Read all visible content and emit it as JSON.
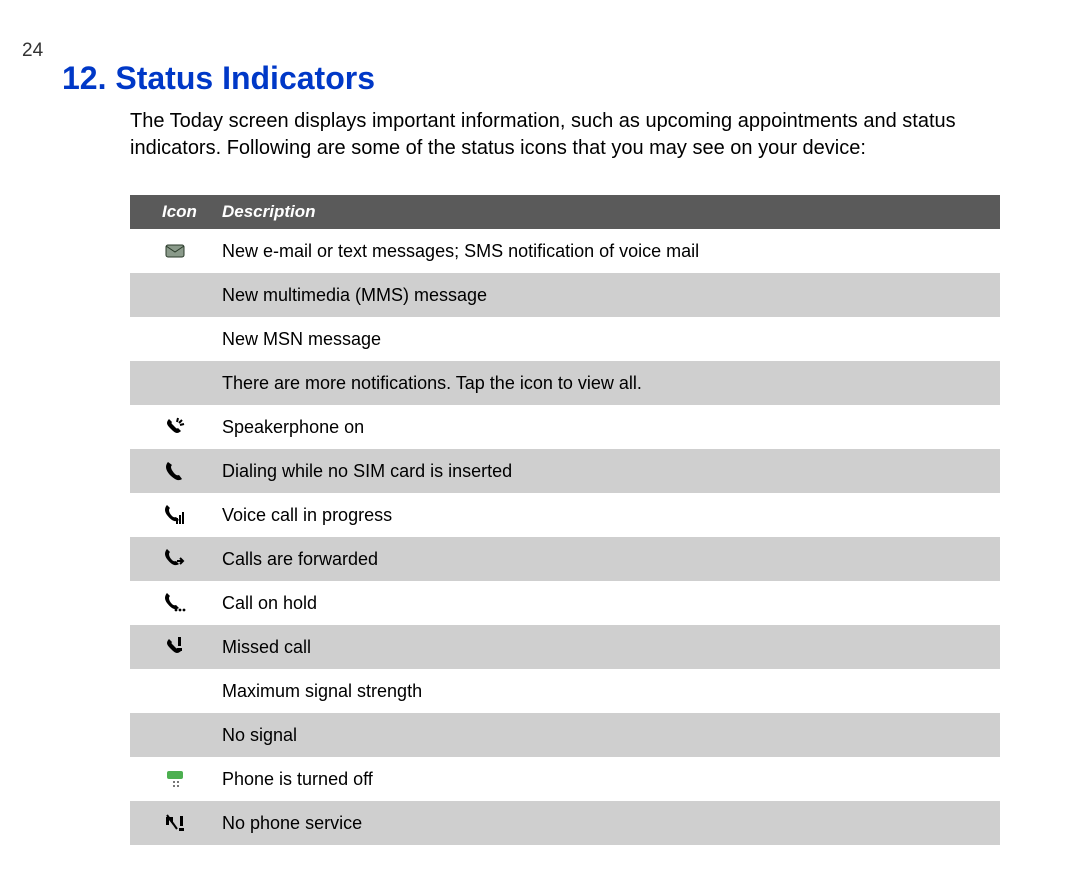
{
  "page_number": "24",
  "heading": "12.  Status Indicators",
  "intro": "The Today screen displays important information, such as upcoming appointments and status indicators. Following are some of the status icons that you may see on your device:",
  "table": {
    "header_icon": "Icon",
    "header_desc": "Description",
    "rows": [
      {
        "icon": "new-mail-icon",
        "desc": "New e-mail or text messages; SMS notification of voice mail",
        "shade": "norm"
      },
      {
        "icon": "",
        "desc": "New multimedia (MMS) message",
        "shade": "alt"
      },
      {
        "icon": "",
        "desc": "New MSN message",
        "shade": "norm"
      },
      {
        "icon": "",
        "desc": "There are more notifications. Tap the icon to view all.",
        "shade": "alt"
      },
      {
        "icon": "speakerphone-icon",
        "desc": "Speakerphone on",
        "shade": "norm"
      },
      {
        "icon": "dialing-no-sim-icon",
        "desc": "Dialing while no SIM card is inserted",
        "shade": "alt"
      },
      {
        "icon": "voice-call-progress-icon",
        "desc": "Voice call in progress",
        "shade": "norm"
      },
      {
        "icon": "calls-forwarded-icon",
        "desc": "Calls are forwarded",
        "shade": "alt"
      },
      {
        "icon": "call-on-hold-icon",
        "desc": "Call on hold",
        "shade": "norm"
      },
      {
        "icon": "missed-call-icon",
        "desc": "Missed call",
        "shade": "alt"
      },
      {
        "icon": "",
        "desc": "Maximum signal strength",
        "shade": "norm"
      },
      {
        "icon": "",
        "desc": "No signal",
        "shade": "alt"
      },
      {
        "icon": "phone-off-icon",
        "desc": "Phone is turned off",
        "shade": "norm"
      },
      {
        "icon": "no-phone-service-icon",
        "desc": "No phone service",
        "shade": "alt"
      }
    ]
  }
}
